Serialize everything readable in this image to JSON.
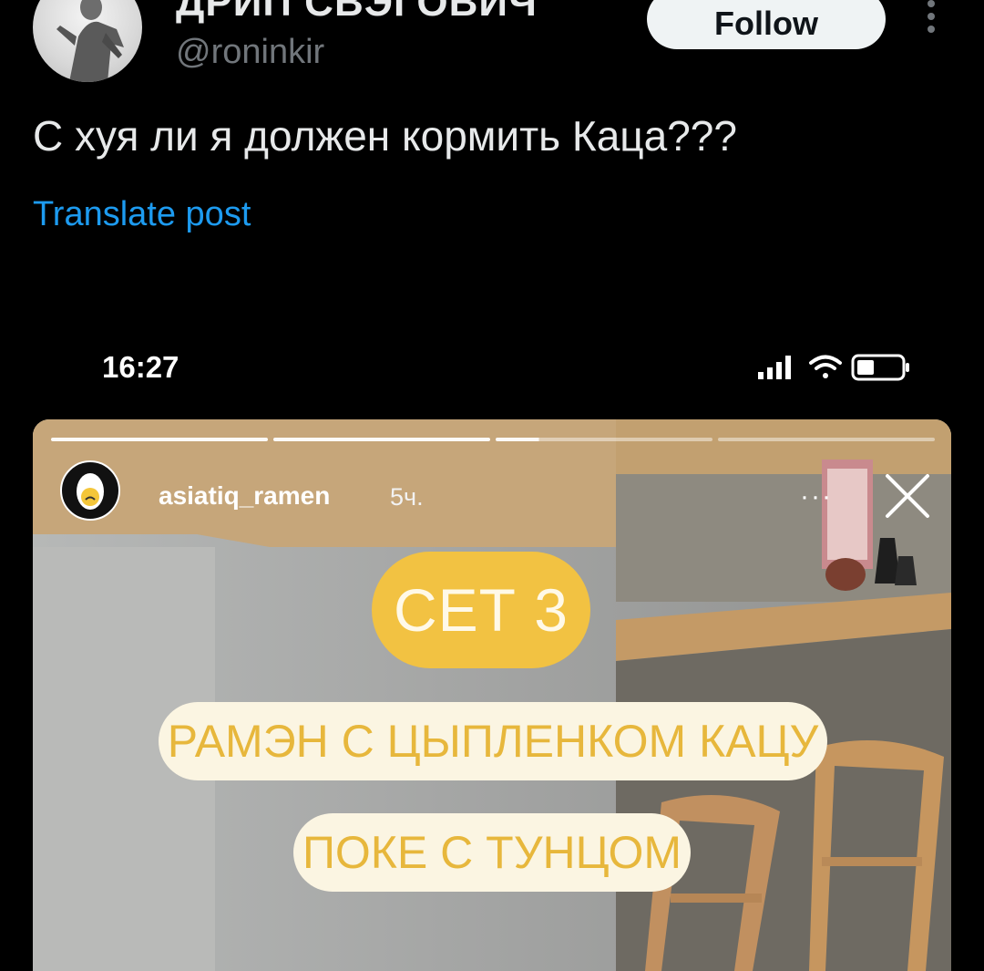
{
  "tweet": {
    "display_name": "ДРИП СВЭГОВИЧ",
    "handle": "@roninkir",
    "follow_label": "Follow",
    "text": "С хуя ли я должен кормить Каца???",
    "translate_label": "Translate post"
  },
  "phone_status": {
    "time": "16:27"
  },
  "story": {
    "username": "asiatiq_ramen",
    "posted_ago": "5ч.",
    "more_label": "···",
    "segments": [
      {
        "state": "done"
      },
      {
        "state": "done"
      },
      {
        "state": "current"
      },
      {
        "state": "pending"
      }
    ],
    "set_title": "СЕТ 3",
    "items": [
      "РАМЭН С ЦЫПЛЕНКОМ КАЦУ",
      "ПОКЕ С ТУНЦОМ"
    ]
  },
  "colors": {
    "background": "#000000",
    "link": "#1d9bf0",
    "secondary_text": "#71767b",
    "sticker_yellow": "#f2c242",
    "sticker_cream": "#fbf5e2",
    "sticker_text": "#e7b73c"
  },
  "icons": {
    "more": "more-vertical-icon",
    "close": "close-icon",
    "signal": "signal-icon",
    "wifi": "wifi-icon",
    "battery": "battery-icon"
  }
}
